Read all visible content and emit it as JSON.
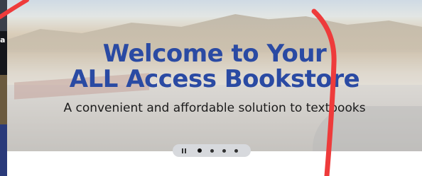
{
  "hero": {
    "title_line1": "Welcome to Your",
    "title_line2": "ALL Access Bookstore",
    "subtitle": "A convenient and affordable solution to textbooks"
  },
  "slider": {
    "slide_count": 4,
    "active_slide": 1
  },
  "left_strip": {
    "crop_letter": "a"
  },
  "colors": {
    "title_blue": "#2a4aa3",
    "annotation_red": "#ee3b3b"
  }
}
